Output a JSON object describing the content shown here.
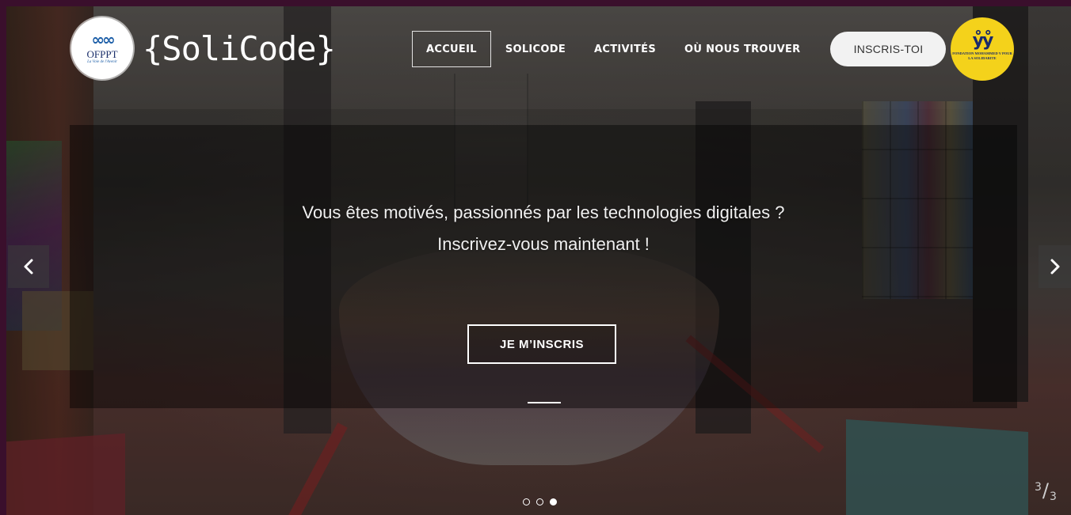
{
  "header": {
    "partner_left": {
      "name": "OFPPT",
      "tagline": "La Voie de l'Avenir",
      "icon": "ofppt-logo"
    },
    "brand_name": "{SoliCode}",
    "nav": [
      {
        "label": "ACCUEIL",
        "active": true
      },
      {
        "label": "SOLICODE",
        "active": false
      },
      {
        "label": "ACTIVITÉS",
        "active": false
      },
      {
        "label": "OÙ NOUS TROUVER",
        "active": false
      }
    ],
    "cta_label": "INSCRIS-TOI",
    "partner_right": {
      "name": "FONDATION MOHAMMED V POUR LA SOLIDARITE",
      "icon": "fondation-logo"
    }
  },
  "slide": {
    "line1": "Vous êtes motivés, passionnés par les technologies digitales ?",
    "line2": "Inscrivez-vous maintenant !",
    "button_label": "JE M’INSCRIS",
    "current": "3",
    "total": "3",
    "dots_total": 3,
    "dots_active_index": 2
  },
  "controls": {
    "prev_icon": "chevron-left-icon",
    "next_icon": "chevron-right-icon"
  },
  "colors": {
    "page_border": "#3a0f2c",
    "cta_background": "#f2f2f2",
    "fondation_yellow": "#f4d21b",
    "ofppt_blue": "#1d5fa8"
  }
}
